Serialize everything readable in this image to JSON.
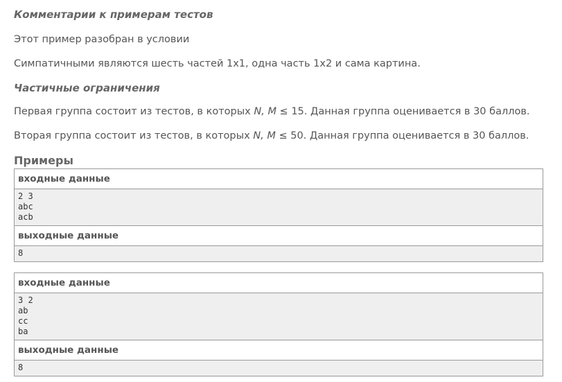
{
  "comments": {
    "heading": "Комментарии к примерам тестов",
    "line1": "Этот пример разобран в условии",
    "line2": "Симпатичными являются шесть частей 1x1, одна часть 1x2 и сама картина."
  },
  "partial": {
    "heading": "Частичные ограничения",
    "group1": {
      "prefix": "Первая группа состоит из тестов, в которых ",
      "vars": "N, M",
      "suffix": " ≤ 15. Данная группа оценивается в 30 баллов."
    },
    "group2": {
      "prefix": "Вторая группа состоит из тестов, в которых ",
      "vars": "N, M",
      "suffix": " ≤ 50. Данная группа оценивается в 30 баллов."
    }
  },
  "examples": {
    "title": "Примеры",
    "samples": [
      {
        "input_label": "входные данные",
        "input": "2 3\nabc\nacb",
        "output_label": "выходные данные",
        "output": "8"
      },
      {
        "input_label": "входные данные",
        "input": "3 2\nab\ncc\nba",
        "output_label": "выходные данные",
        "output": "8"
      }
    ]
  }
}
